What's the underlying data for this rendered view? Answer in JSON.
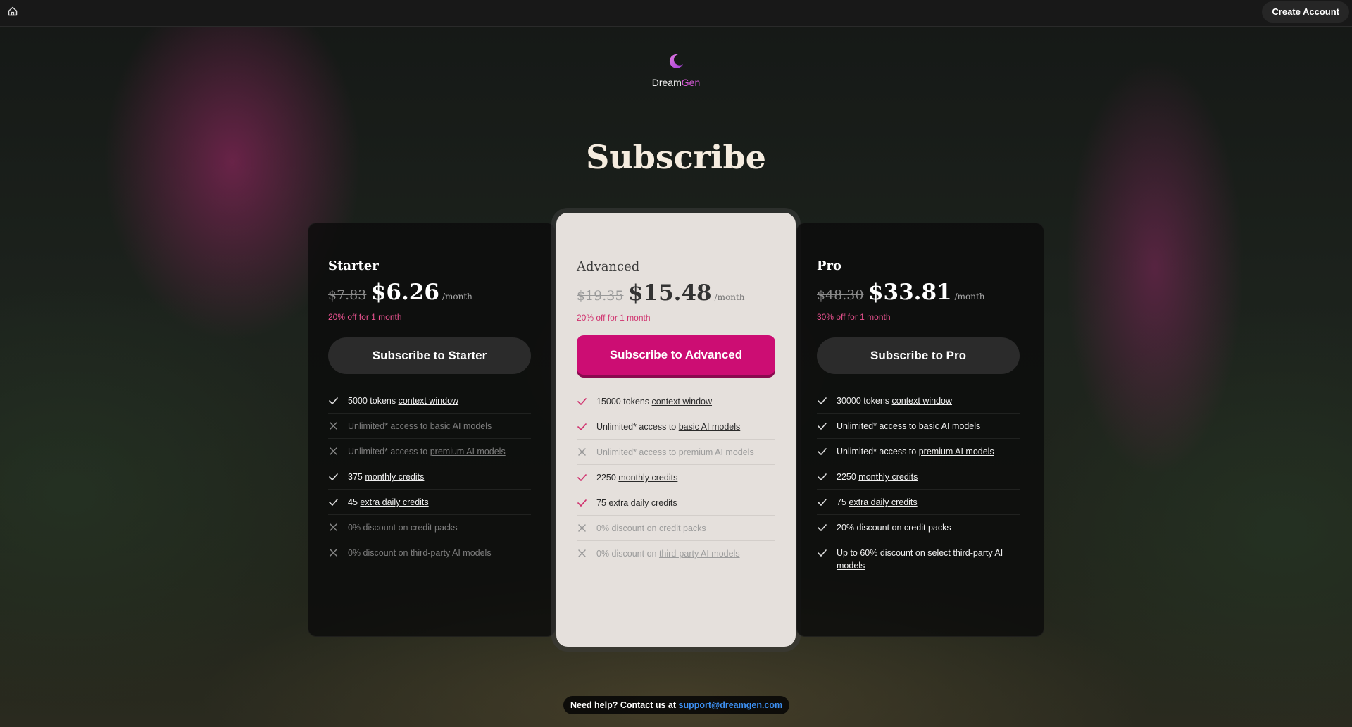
{
  "topbar": {
    "create_account": "Create Account"
  },
  "logo": {
    "part1": "Dream",
    "part2": "Gen"
  },
  "title": "Subscribe",
  "plans": [
    {
      "name": "Starter",
      "old_price": "$7.83",
      "price": "$6.26",
      "period": "/month",
      "discount": "20% off for 1 month",
      "button": "Subscribe to Starter",
      "features": [
        {
          "on": true,
          "pre": "5000 tokens ",
          "link": "context window",
          "post": ""
        },
        {
          "on": false,
          "pre": "Unlimited* access to ",
          "link": "basic AI models",
          "post": ""
        },
        {
          "on": false,
          "pre": "Unlimited* access to ",
          "link": "premium AI models",
          "post": ""
        },
        {
          "on": true,
          "pre": "375 ",
          "link": "monthly credits",
          "post": ""
        },
        {
          "on": true,
          "pre": "45 ",
          "link": "extra daily credits",
          "post": ""
        },
        {
          "on": false,
          "pre": "0% discount on credit packs",
          "link": "",
          "post": ""
        },
        {
          "on": false,
          "pre": "0% discount on ",
          "link": "third-party AI models",
          "post": ""
        }
      ]
    },
    {
      "name": "Advanced",
      "old_price": "$19.35",
      "price": "$15.48",
      "period": "/month",
      "discount": "20% off for 1 month",
      "button": "Subscribe to Advanced",
      "features": [
        {
          "on": true,
          "pre": "15000 tokens ",
          "link": "context window",
          "post": ""
        },
        {
          "on": true,
          "pre": "Unlimited* access to ",
          "link": "basic AI models",
          "post": ""
        },
        {
          "on": false,
          "pre": "Unlimited* access to ",
          "link": "premium AI models",
          "post": ""
        },
        {
          "on": true,
          "pre": "2250 ",
          "link": "monthly credits",
          "post": ""
        },
        {
          "on": true,
          "pre": "75 ",
          "link": "extra daily credits",
          "post": ""
        },
        {
          "on": false,
          "pre": "0% discount on credit packs",
          "link": "",
          "post": ""
        },
        {
          "on": false,
          "pre": "0% discount on ",
          "link": "third-party AI models",
          "post": ""
        }
      ]
    },
    {
      "name": "Pro",
      "old_price": "$48.30",
      "price": "$33.81",
      "period": "/month",
      "discount": "30% off for 1 month",
      "button": "Subscribe to Pro",
      "features": [
        {
          "on": true,
          "pre": "30000 tokens ",
          "link": "context window",
          "post": ""
        },
        {
          "on": true,
          "pre": "Unlimited* access to ",
          "link": "basic AI models",
          "post": ""
        },
        {
          "on": true,
          "pre": "Unlimited* access to ",
          "link": "premium AI models",
          "post": ""
        },
        {
          "on": true,
          "pre": "2250 ",
          "link": "monthly credits",
          "post": ""
        },
        {
          "on": true,
          "pre": "75 ",
          "link": "extra daily credits",
          "post": ""
        },
        {
          "on": true,
          "pre": "20% discount on credit packs",
          "link": "",
          "post": ""
        },
        {
          "on": true,
          "pre": "Up to 60% discount on select ",
          "link": "third-party AI models",
          "post": ""
        }
      ]
    }
  ],
  "help": {
    "text": "Need help? Contact us at ",
    "email": "support@dreamgen.com"
  },
  "colors": {
    "accent": "#cc0d73",
    "discount": "#e8528f",
    "link": "#3d8ff0"
  }
}
